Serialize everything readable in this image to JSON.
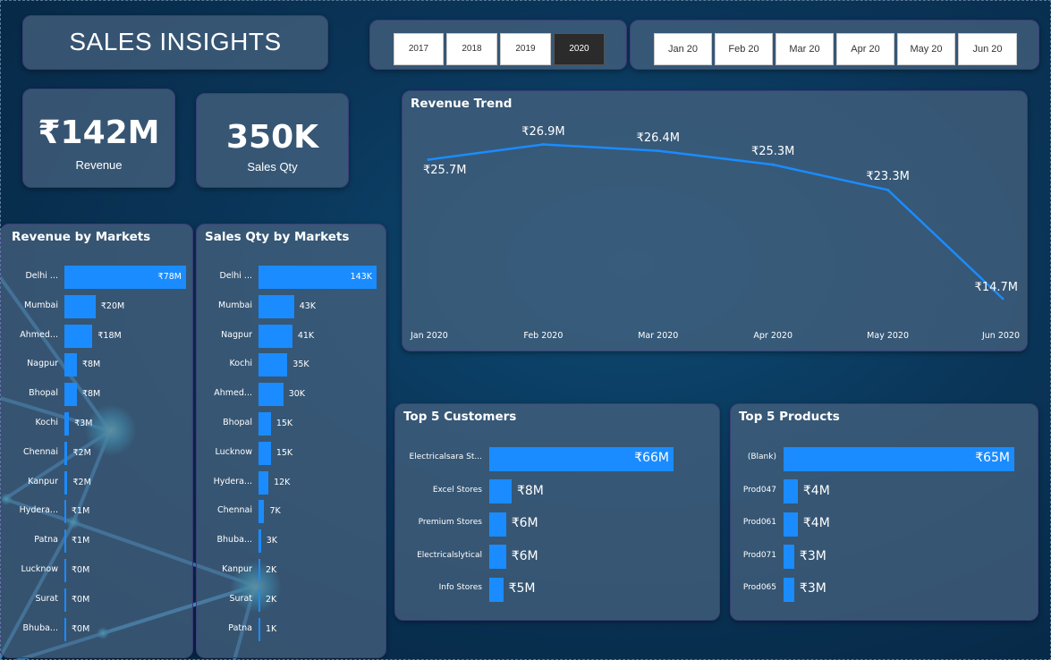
{
  "title": "SALES INSIGHTS",
  "years": [
    "2017",
    "2018",
    "2019",
    "2020"
  ],
  "selected_year": "2020",
  "months": [
    "Jan 20",
    "Feb 20",
    "Mar 20",
    "Apr 20",
    "May 20",
    "Jun 20"
  ],
  "kpis": {
    "revenue": {
      "value": "₹142M",
      "label": "Revenue"
    },
    "qty": {
      "value": "350K",
      "label": "Sales Qty"
    }
  },
  "colors": {
    "bar": "#1a8cff",
    "line": "#1a8cff",
    "selected_button": "#2b2b2b"
  },
  "chart_data": [
    {
      "type": "line",
      "title": "Revenue Trend",
      "x": [
        "Jan 2020",
        "Feb 2020",
        "Mar 2020",
        "Apr 2020",
        "May 2020",
        "Jun 2020"
      ],
      "values": [
        25.7,
        26.9,
        26.4,
        25.3,
        23.3,
        14.7
      ],
      "data_labels": [
        "₹25.7M",
        "₹26.9M",
        "₹26.4M",
        "₹25.3M",
        "₹23.3M",
        "₹14.7M"
      ],
      "unit": "₹M"
    },
    {
      "type": "bar",
      "orientation": "horizontal",
      "title": "Revenue by Markets",
      "categories": [
        "Delhi ...",
        "Mumbai",
        "Ahmed...",
        "Nagpur",
        "Bhopal",
        "Kochi",
        "Chennai",
        "Kanpur",
        "Hydera...",
        "Patna",
        "Lucknow",
        "Surat",
        "Bhuba..."
      ],
      "values": [
        78,
        20,
        18,
        8,
        8,
        3,
        2,
        2,
        1,
        1,
        0,
        0,
        0
      ],
      "data_labels": [
        "₹78M",
        "₹20M",
        "₹18M",
        "₹8M",
        "₹8M",
        "₹3M",
        "₹2M",
        "₹2M",
        "₹1M",
        "₹1M",
        "₹0M",
        "₹0M",
        "₹0M"
      ]
    },
    {
      "type": "bar",
      "orientation": "horizontal",
      "title": "Sales Qty by Markets",
      "categories": [
        "Delhi ...",
        "Mumbai",
        "Nagpur",
        "Kochi",
        "Ahmed...",
        "Bhopal",
        "Lucknow",
        "Hydera...",
        "Chennai",
        "Bhuba...",
        "Kanpur",
        "Surat",
        "Patna"
      ],
      "values": [
        143,
        43,
        41,
        35,
        30,
        15,
        15,
        12,
        7,
        3,
        2,
        2,
        1
      ],
      "data_labels": [
        "143K",
        "43K",
        "41K",
        "35K",
        "30K",
        "15K",
        "15K",
        "12K",
        "7K",
        "3K",
        "2K",
        "2K",
        "1K"
      ]
    },
    {
      "type": "bar",
      "orientation": "horizontal",
      "title": "Top 5 Customers",
      "categories": [
        "Electricalsara St...",
        "Excel Stores",
        "Premium Stores",
        "Electricalslytical",
        "Info Stores"
      ],
      "values": [
        66,
        8,
        6,
        6,
        5
      ],
      "data_labels": [
        "₹66M",
        "₹8M",
        "₹6M",
        "₹6M",
        "₹5M"
      ]
    },
    {
      "type": "bar",
      "orientation": "horizontal",
      "title": "Top 5 Products",
      "categories": [
        "(Blank)",
        "Prod047",
        "Prod061",
        "Prod071",
        "Prod065"
      ],
      "values": [
        65,
        4,
        4,
        3,
        3
      ],
      "data_labels": [
        "₹65M",
        "₹4M",
        "₹4M",
        "₹3M",
        "₹3M"
      ]
    }
  ]
}
